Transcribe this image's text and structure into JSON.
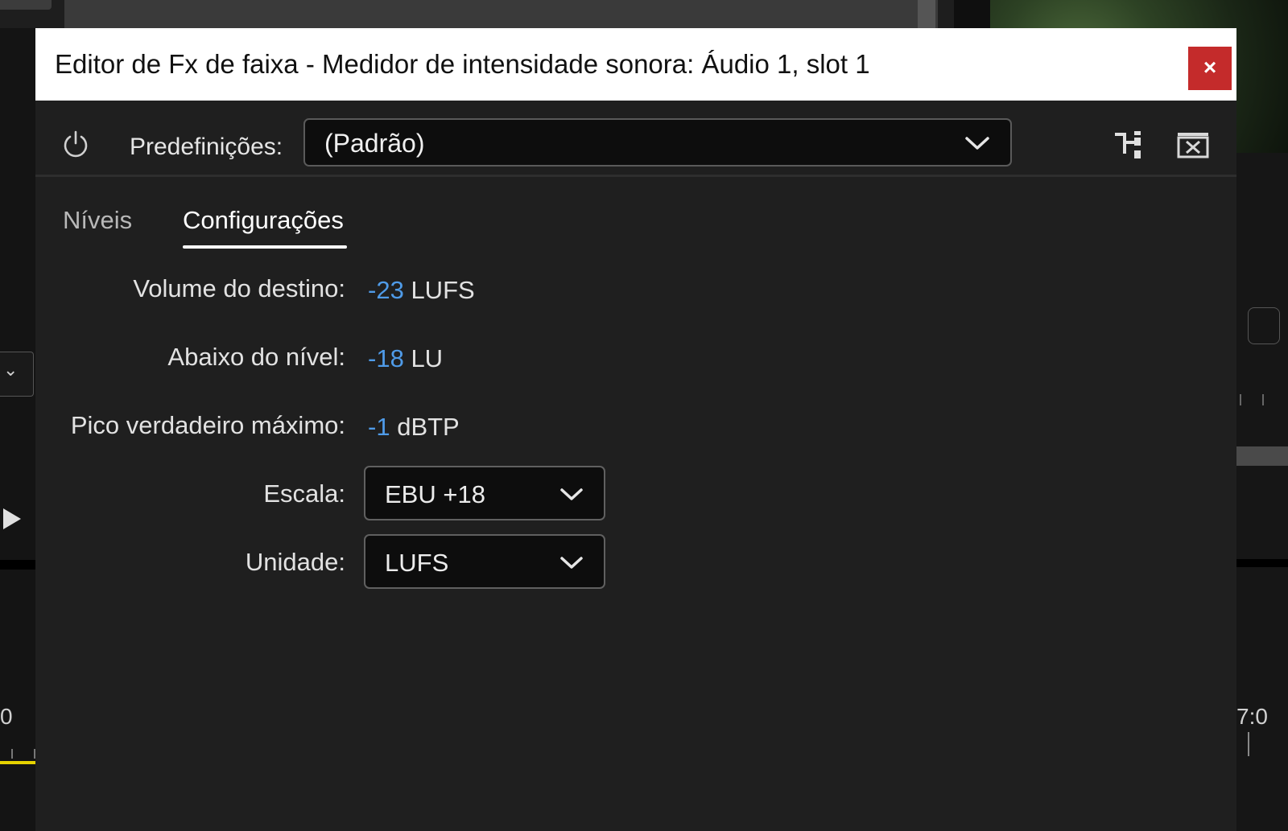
{
  "window": {
    "title": "Editor de Fx de faixa - Medidor de intensidade sonora: Áudio 1, slot 1",
    "close_label": "×"
  },
  "toolbar": {
    "power_icon": "power-icon",
    "presets_label": "Predefinições:",
    "presets_value": "(Padrão)",
    "icons": [
      "routing-icon",
      "delete-preset-icon"
    ]
  },
  "tabs": [
    {
      "label": "Níveis",
      "active": false
    },
    {
      "label": "Configurações",
      "active": true
    }
  ],
  "settings": {
    "target_volume": {
      "label": "Volume do destino:",
      "value": "-23",
      "unit": "LUFS"
    },
    "below_level": {
      "label": "Abaixo do nível:",
      "value": "-18",
      "unit": "LU"
    },
    "max_true_peak": {
      "label": "Pico verdadeiro máximo:",
      "value": "-1",
      "unit": "dBTP"
    },
    "scale": {
      "label": "Escala:",
      "value": "EBU +18"
    },
    "unit": {
      "label": "Unidade:",
      "value": "LUFS"
    }
  },
  "background": {
    "left_timecode": "0",
    "right_timecode": "7:0"
  },
  "colors": {
    "accent_value": "#4f9be8",
    "close_button": "#c42b2b",
    "dialog_bg": "#1f1f1f"
  }
}
